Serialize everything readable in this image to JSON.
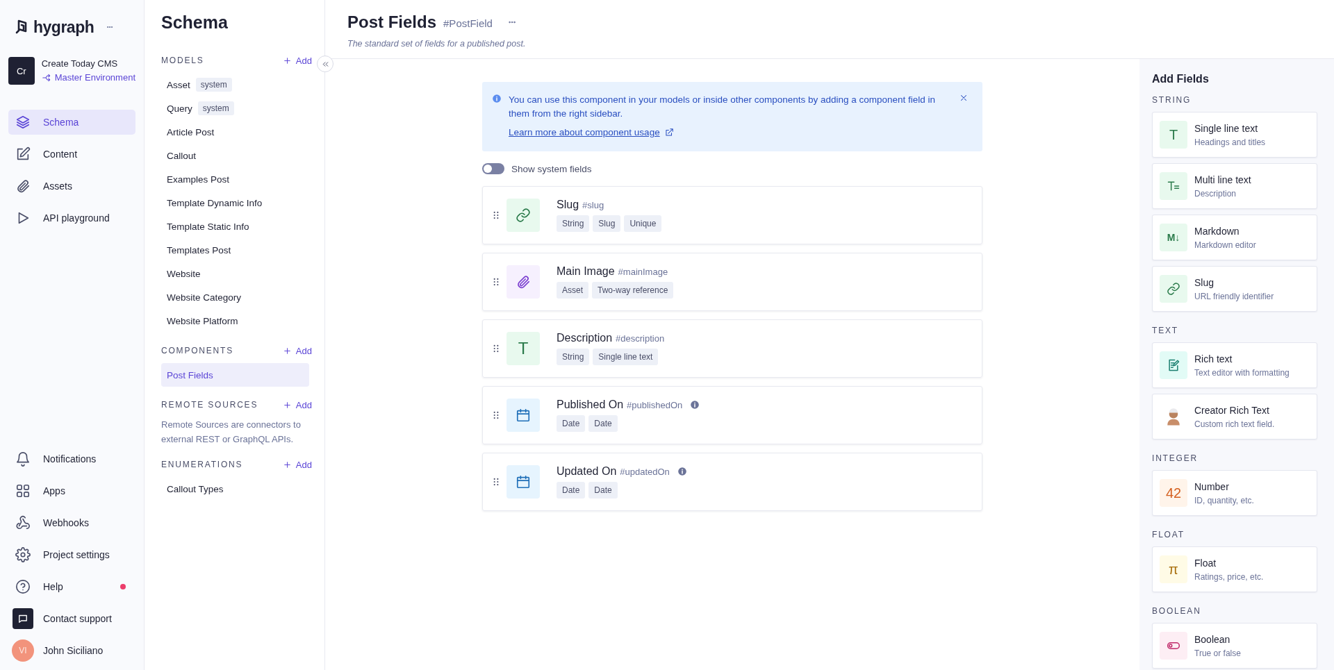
{
  "nav": {
    "logo": "hygraph",
    "project": {
      "initials": "Cr",
      "name": "Create Today CMS",
      "environment": "Master Environment"
    },
    "items": [
      {
        "label": "Schema",
        "selected": true
      },
      {
        "label": "Content",
        "selected": false
      },
      {
        "label": "Assets",
        "selected": false
      },
      {
        "label": "API playground",
        "selected": false
      }
    ],
    "bottom_items": [
      {
        "label": "Notifications",
        "badge": false
      },
      {
        "label": "Apps",
        "badge": false
      },
      {
        "label": "Webhooks",
        "badge": false
      },
      {
        "label": "Project settings",
        "badge": false
      },
      {
        "label": "Help",
        "badge": true
      },
      {
        "label": "Contact support",
        "badge": false
      }
    ],
    "user": {
      "initials": "VI",
      "name": "John Siciliano"
    }
  },
  "schema": {
    "title": "Schema",
    "sections": [
      {
        "heading": "MODELS",
        "add": "Add",
        "items": [
          {
            "label": "Asset",
            "tag": "system",
            "selected": false
          },
          {
            "label": "Query",
            "tag": "system",
            "selected": false
          },
          {
            "label": "Article Post",
            "selected": false
          },
          {
            "label": "Callout",
            "selected": false
          },
          {
            "label": "Examples Post",
            "selected": false
          },
          {
            "label": "Template Dynamic Info",
            "selected": false
          },
          {
            "label": "Template Static Info",
            "selected": false
          },
          {
            "label": "Templates Post",
            "selected": false
          },
          {
            "label": "Website",
            "selected": false
          },
          {
            "label": "Website Category",
            "selected": false
          },
          {
            "label": "Website Platform",
            "selected": false
          }
        ]
      },
      {
        "heading": "COMPONENTS",
        "add": "Add",
        "items": [
          {
            "label": "Post Fields",
            "selected": true
          }
        ]
      },
      {
        "heading": "REMOTE SOURCES",
        "add": "Add",
        "description": "Remote Sources are connectors to external REST or GraphQL APIs."
      },
      {
        "heading": "ENUMERATIONS",
        "add": "Add",
        "items": [
          {
            "label": "Callout Types",
            "selected": false
          }
        ]
      }
    ]
  },
  "component": {
    "title": "Post Fields",
    "api_id": "#PostField",
    "description": "The standard set of fields for a published post.",
    "notice": {
      "text": "You can use this component in your models or inside other components by adding a component field in them from the right sidebar.",
      "link": "Learn more about component usage"
    },
    "system_toggle": {
      "label": "Show system fields",
      "on": false
    },
    "fields": [
      {
        "name": "Slug",
        "api_id": "#slug",
        "icon": {
          "kind": "link"
        },
        "tags": [
          "String",
          "Slug",
          "Unique"
        ],
        "info": false
      },
      {
        "name": "Main Image",
        "api_id": "#mainImage",
        "icon": {
          "kind": "clip"
        },
        "tags": [
          "Asset",
          "Two-way reference"
        ],
        "info": false
      },
      {
        "name": "Description",
        "api_id": "#description",
        "icon": {
          "kind": "text",
          "glyph": "T"
        },
        "tags": [
          "String",
          "Single line text"
        ],
        "info": false
      },
      {
        "name": "Published On",
        "api_id": "#publishedOn",
        "icon": {
          "kind": "calendar"
        },
        "tags": [
          "Date",
          "Date"
        ],
        "info": true
      },
      {
        "name": "Updated On",
        "api_id": "#updatedOn",
        "icon": {
          "kind": "calendar"
        },
        "tags": [
          "Date",
          "Date"
        ],
        "info": true
      }
    ]
  },
  "add_fields": {
    "title": "Add Fields",
    "groups": [
      {
        "heading": "STRING",
        "items": [
          {
            "title": "Single line text",
            "subtitle": "Headings and titles",
            "icon": {
              "kind": "text",
              "glyph": "T"
            }
          },
          {
            "title": "Multi line text",
            "subtitle": "Description",
            "icon": {
              "kind": "multiline"
            }
          },
          {
            "title": "Markdown",
            "subtitle": "Markdown editor",
            "icon": {
              "kind": "markdown",
              "glyph": "M↓"
            }
          },
          {
            "title": "Slug",
            "subtitle": "URL friendly identifier",
            "icon": {
              "kind": "link"
            }
          }
        ]
      },
      {
        "heading": "TEXT",
        "items": [
          {
            "title": "Rich text",
            "subtitle": "Text editor with formatting",
            "icon": {
              "kind": "richtext"
            }
          },
          {
            "title": "Creator Rich Text",
            "subtitle": "Custom rich text field.",
            "icon": {
              "kind": "avatar"
            }
          }
        ]
      },
      {
        "heading": "INTEGER",
        "items": [
          {
            "title": "Number",
            "subtitle": "ID, quantity, etc.",
            "icon": {
              "kind": "number",
              "glyph": "42"
            }
          }
        ]
      },
      {
        "heading": "FLOAT",
        "items": [
          {
            "title": "Float",
            "subtitle": "Ratings, price, etc.",
            "icon": {
              "kind": "float",
              "glyph": "π"
            }
          }
        ]
      },
      {
        "heading": "BOOLEAN",
        "items": [
          {
            "title": "Boolean",
            "subtitle": "True or false",
            "icon": {
              "kind": "boolean"
            }
          }
        ]
      }
    ]
  }
}
